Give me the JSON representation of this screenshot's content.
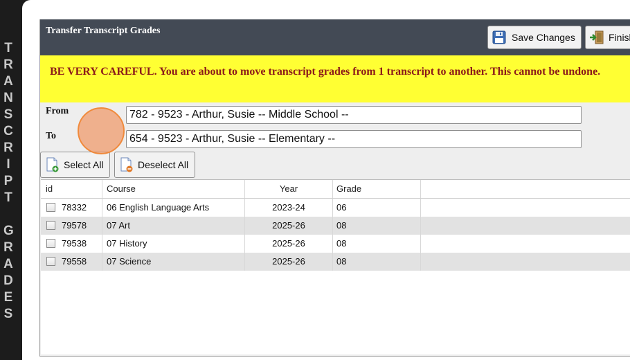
{
  "sidebar_title_letters": [
    "T",
    "R",
    "A",
    "N",
    "S",
    "C",
    "R",
    "I",
    "P",
    "T",
    " ",
    "G",
    "R",
    "A",
    "D",
    "E",
    "S"
  ],
  "header": {
    "title": "Transfer Transcript Grades",
    "save_label": "Save Changes",
    "finish_label": "Finish"
  },
  "warning": {
    "text": "BE VERY CAREFUL. You are about to move transcript grades from 1 transcript to another. This cannot be undone."
  },
  "form": {
    "from_label": "From",
    "from_value": "782 - 9523 - Arthur, Susie -- Middle School --",
    "to_label": "To",
    "to_value": "654 - 9523 - Arthur, Susie -- Elementary --"
  },
  "buttons": {
    "select_all": "Select All",
    "deselect_all": "Deselect All"
  },
  "table": {
    "columns": [
      "id",
      "Course",
      "Year",
      "Grade"
    ],
    "rows": [
      {
        "id": "78332",
        "course": "06 English Language Arts",
        "year": "2023-24",
        "grade": "06"
      },
      {
        "id": "79578",
        "course": "07 Art",
        "year": "2025-26",
        "grade": "08"
      },
      {
        "id": "79538",
        "course": "07 History",
        "year": "2025-26",
        "grade": "08"
      },
      {
        "id": "79558",
        "course": "07 Science",
        "year": "2025-26",
        "grade": "08"
      }
    ]
  },
  "colors": {
    "header_bg": "#434a55",
    "warning_bg": "#ffff33",
    "warning_text": "#8b1a1a",
    "row_alt": "#e2e2e2"
  }
}
